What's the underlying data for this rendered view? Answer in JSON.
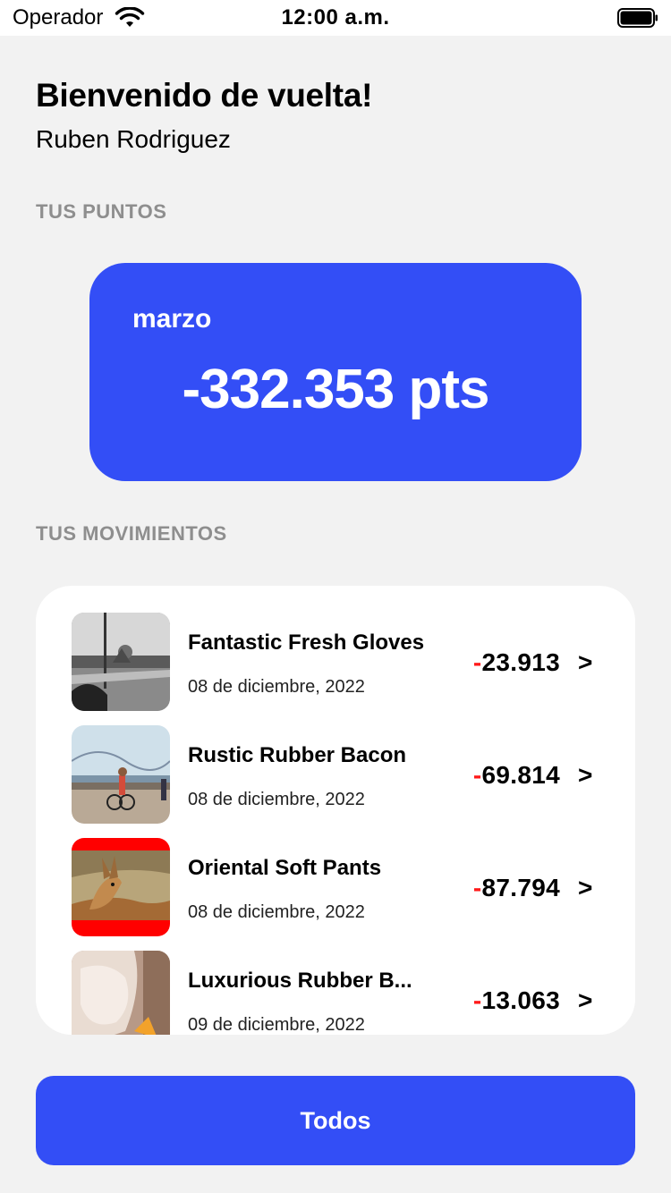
{
  "status_bar": {
    "carrier": "Operador",
    "time": "12:00 a.m."
  },
  "header": {
    "welcome": "Bienvenido de vuelta!",
    "user_name": "Ruben Rodriguez"
  },
  "points": {
    "section_label": "TUS PUNTOS",
    "month": "marzo",
    "value": "-332.353 pts"
  },
  "movements": {
    "section_label": "TUS MOVIMIENTOS",
    "items": [
      {
        "title": "Fantastic Fresh Gloves",
        "date": "08 de diciembre, 2022",
        "sign": "-",
        "amount": "23.913",
        "chevron": ">"
      },
      {
        "title": "Rustic Rubber Bacon",
        "date": "08 de diciembre, 2022",
        "sign": "-",
        "amount": "69.814",
        "chevron": ">"
      },
      {
        "title": "Oriental Soft Pants",
        "date": "08 de diciembre, 2022",
        "sign": "-",
        "amount": "87.794",
        "chevron": ">"
      },
      {
        "title": "Luxurious Rubber B...",
        "date": "09 de diciembre, 2022",
        "sign": "-",
        "amount": "13.063",
        "chevron": ">"
      }
    ]
  },
  "button": {
    "label": "Todos"
  },
  "colors": {
    "accent": "#334ef6",
    "negative": "#ff1a1a",
    "background": "#f2f2f2",
    "section_label": "#8e8e8e"
  },
  "icons": [
    "wifi-icon",
    "battery-icon",
    "chevron-right-icon"
  ]
}
